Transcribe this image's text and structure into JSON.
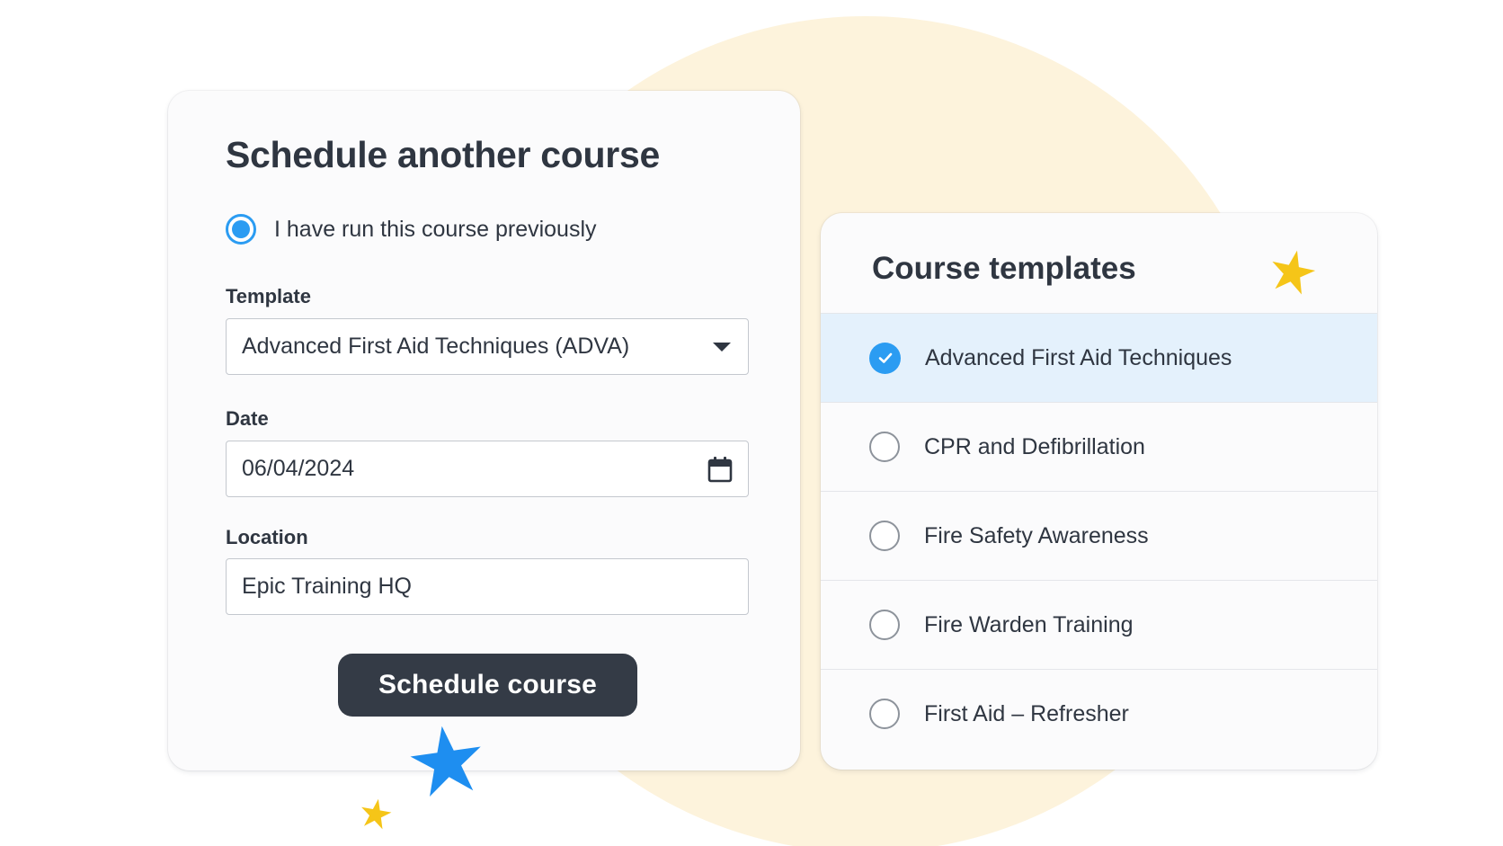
{
  "colors": {
    "accent_blue": "#2b9cf2",
    "dark_button": "#343b46",
    "star_yellow": "#f5c518",
    "star_blue": "#1e8ef0",
    "background_circle": "#fdf3dc",
    "selected_row": "#e4f1fc"
  },
  "form": {
    "title": "Schedule another course",
    "previous_option": {
      "label": "I have run this course previously",
      "selected": true
    },
    "template": {
      "label": "Template",
      "value": "Advanced First Aid Techniques (ADVA)",
      "icon": "chevron-down-icon"
    },
    "date": {
      "label": "Date",
      "value": "06/04/2024",
      "icon": "calendar-icon"
    },
    "location": {
      "label": "Location",
      "value": "Epic Training HQ"
    },
    "submit_label": "Schedule course"
  },
  "templates": {
    "title": "Course templates",
    "items": [
      {
        "label": "Advanced First Aid Techniques",
        "selected": true
      },
      {
        "label": "CPR and Defibrillation",
        "selected": false
      },
      {
        "label": "Fire Safety Awareness",
        "selected": false
      },
      {
        "label": "Fire Warden Training",
        "selected": false
      },
      {
        "label": "First Aid – Refresher",
        "selected": false
      }
    ]
  }
}
